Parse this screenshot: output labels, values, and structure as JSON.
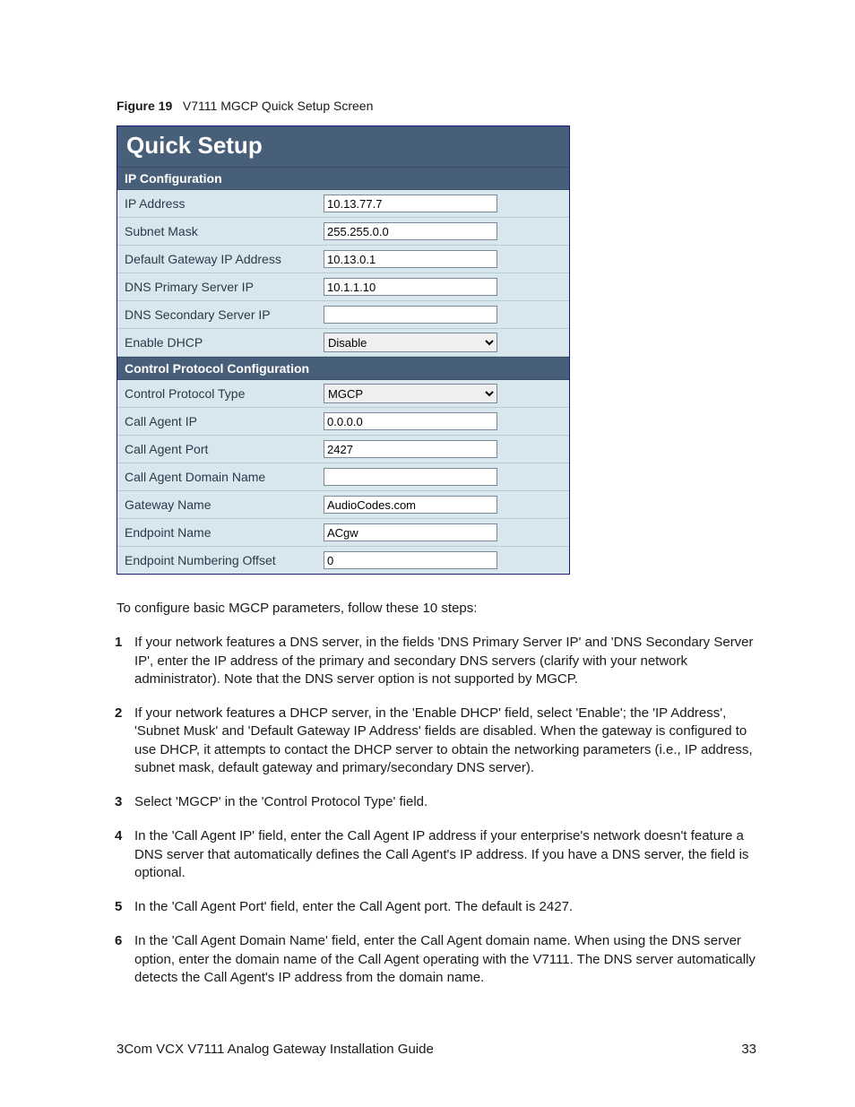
{
  "figure": {
    "label": "Figure 19",
    "caption": "V7111 MGCP Quick Setup Screen"
  },
  "panel": {
    "title": "Quick Setup",
    "sections": [
      {
        "header": "IP Configuration",
        "rows": [
          {
            "label": "IP Address",
            "value": "10.13.77.7",
            "type": "text"
          },
          {
            "label": "Subnet Mask",
            "value": "255.255.0.0",
            "type": "text"
          },
          {
            "label": "Default Gateway IP Address",
            "value": "10.13.0.1",
            "type": "text"
          },
          {
            "label": "DNS Primary Server IP",
            "value": "10.1.1.10",
            "type": "text"
          },
          {
            "label": "DNS Secondary Server IP",
            "value": "",
            "type": "text"
          },
          {
            "label": "Enable DHCP",
            "value": "Disable",
            "type": "select"
          }
        ]
      },
      {
        "header": "Control Protocol Configuration",
        "rows": [
          {
            "label": "Control Protocol Type",
            "value": "MGCP",
            "type": "select"
          },
          {
            "label": "Call Agent IP",
            "value": "0.0.0.0",
            "type": "text"
          },
          {
            "label": "Call Agent Port",
            "value": "2427",
            "type": "text"
          },
          {
            "label": "Call Agent Domain Name",
            "value": "",
            "type": "text"
          },
          {
            "label": "Gateway Name",
            "value": "AudioCodes.com",
            "type": "text"
          },
          {
            "label": "Endpoint Name",
            "value": "ACgw",
            "type": "text"
          },
          {
            "label": "Endpoint Numbering Offset",
            "value": "0",
            "type": "text"
          }
        ]
      }
    ]
  },
  "intro": "To configure basic MGCP parameters, follow these 10 steps:",
  "steps": [
    "If your network features a DNS server, in the fields 'DNS Primary Server IP' and 'DNS Secondary Server IP', enter the IP address of the primary and secondary DNS servers (clarify with your network administrator). Note that the DNS server option is not supported by MGCP.",
    "If your network features a DHCP server, in the 'Enable DHCP' field, select 'Enable'; the 'IP Address', 'Subnet Musk' and 'Default Gateway IP Address' fields are disabled. When the gateway is configured to use DHCP, it attempts to contact the DHCP server to obtain the networking parameters (i.e., IP address, subnet mask, default gateway and primary/secondary DNS server).",
    "Select 'MGCP' in the 'Control Protocol Type' field.",
    "In the 'Call Agent IP' field, enter the Call Agent IP address if your enterprise's network doesn't feature a DNS server that automatically defines the Call Agent's IP address. If you have a DNS server, the field is optional.",
    "In the 'Call Agent Port' field, enter the Call Agent port. The default is 2427.",
    "In the 'Call Agent Domain Name' field, enter the Call Agent domain name. When using the DNS server option, enter the domain name of the Call Agent operating with the V7111. The DNS server automatically detects the Call Agent's IP address from the domain name."
  ],
  "footer": {
    "title": "3Com VCX V7111 Analog Gateway Installation Guide",
    "page": "33"
  }
}
